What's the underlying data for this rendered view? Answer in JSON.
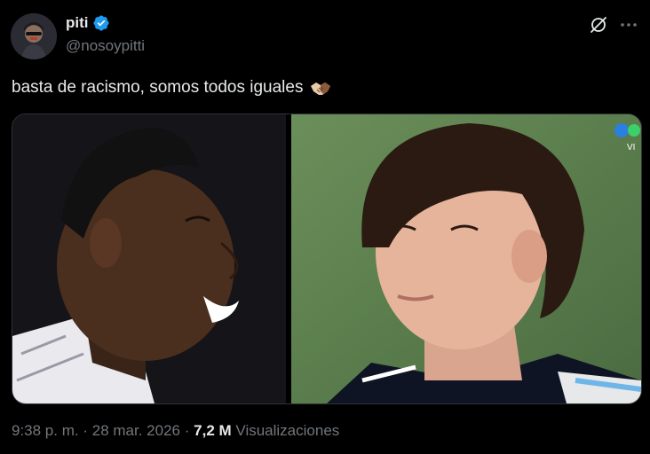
{
  "author": {
    "display_name": "piti",
    "handle": "@nosoypitti",
    "verified": true
  },
  "icons": {
    "verified": "verified-badge-icon",
    "grok": "grok-icon",
    "more": "more-icon",
    "emoji": "handshake-emoji"
  },
  "tweet": {
    "text": "basta de racismo, somos todos iguales",
    "emoji": "🤝🏽"
  },
  "media": {
    "count": 2,
    "right_overlay_text": "VI"
  },
  "meta": {
    "time": "9:38 p. m.",
    "separator": "·",
    "date": "28 mar. 2026",
    "separator2": "·",
    "views_count": "7,2 M",
    "views_label": "Visualizaciones"
  },
  "colors": {
    "background": "#000000",
    "text_primary": "#e7e9ea",
    "text_secondary": "#71767b",
    "verified_blue": "#1d9bf0",
    "border": "#2f3336"
  }
}
